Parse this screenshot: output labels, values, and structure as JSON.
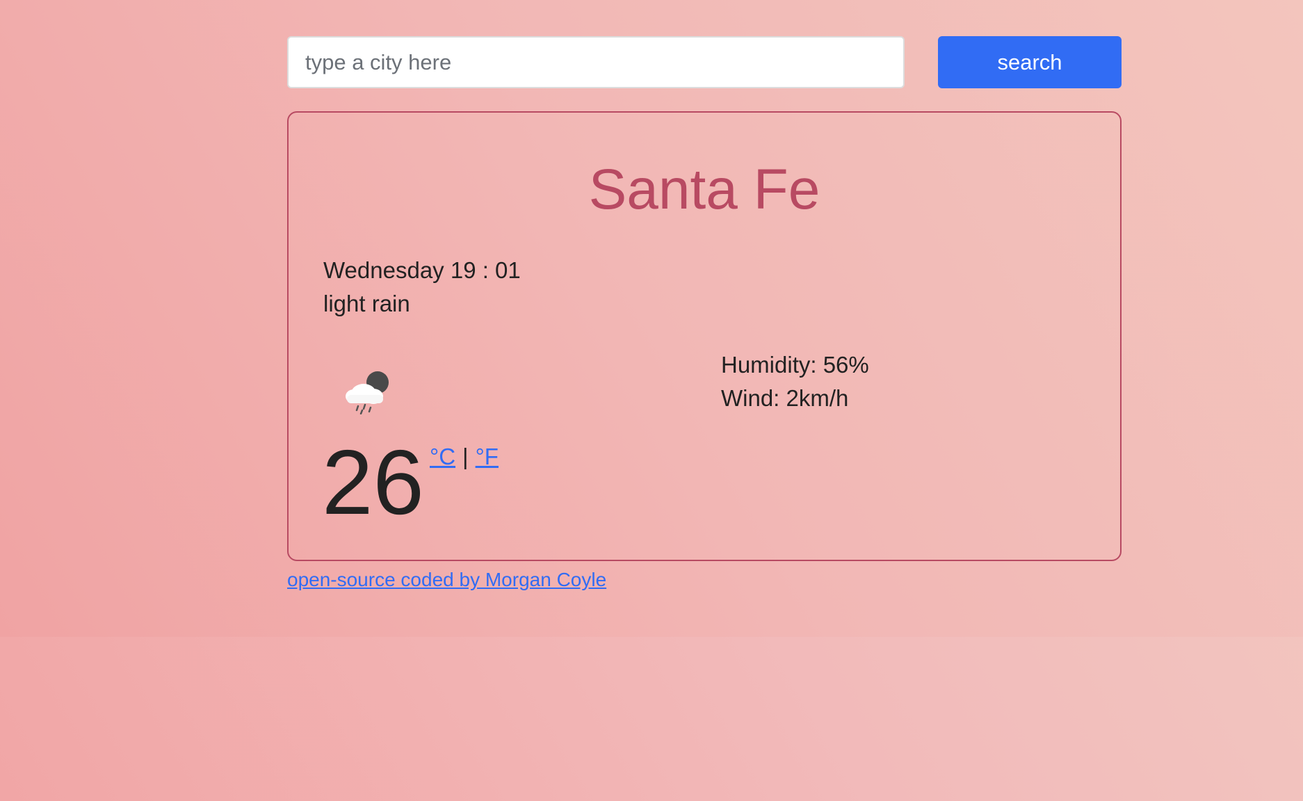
{
  "search": {
    "placeholder": "type a city here",
    "value": "",
    "button_label": "search"
  },
  "weather": {
    "city": "Santa Fe",
    "date_time": "Wednesday 19 : 01",
    "description": "light rain",
    "icon": "rain-cloud-night-icon",
    "temperature": "26",
    "unit_celsius": "°C",
    "unit_separator": "|",
    "unit_fahrenheit": "°F",
    "humidity": "Humidity: 56%",
    "wind": "Wind: 2km/h"
  },
  "footer": {
    "link_text": "open-source coded by Morgan Coyle"
  },
  "colors": {
    "accent": "#316cf4",
    "city": "#b84a62",
    "card_border": "#b84a62"
  }
}
